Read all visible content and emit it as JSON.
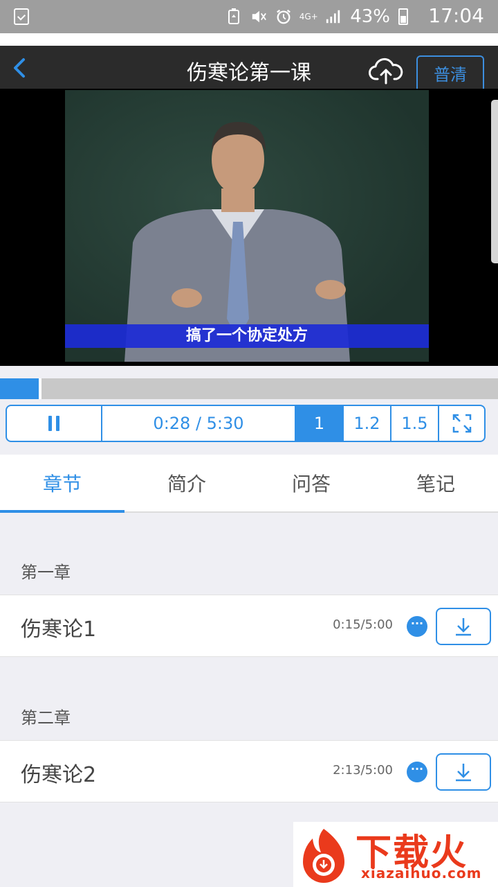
{
  "status_bar": {
    "battery_percent": "43%",
    "time": "17:04",
    "network": "4G+",
    "icons": [
      "screenshot-icon",
      "battery-saver-icon",
      "mute-icon",
      "alarm-icon",
      "network-4g-icon",
      "signal-icon",
      "battery-icon"
    ]
  },
  "header": {
    "title": "伤寒论第一课",
    "quality_label": "普清",
    "icons": [
      "back-icon",
      "cloud-upload-icon"
    ]
  },
  "video": {
    "subtitle": "搞了一个协定处方"
  },
  "player": {
    "progress_fraction": 0.085,
    "time_display": "0:28 / 5:30",
    "speeds": [
      "1",
      "1.2",
      "1.5"
    ],
    "active_speed": "1",
    "icons": [
      "pause-icon",
      "fullscreen-icon"
    ]
  },
  "tabs": [
    {
      "label": "章节",
      "active": true
    },
    {
      "label": "简介",
      "active": false
    },
    {
      "label": "问答",
      "active": false
    },
    {
      "label": "笔记",
      "active": false
    }
  ],
  "chapters": [
    {
      "title": "第一章",
      "lesson": "伤寒论1",
      "progress": "0:15/5:00"
    },
    {
      "title": "第二章",
      "lesson": "伤寒论2",
      "progress": "2:13/5:00"
    }
  ],
  "watermark": {
    "name": "下载火",
    "domain": "xiazaihuo.com"
  },
  "colors": {
    "accent": "#2f8fe6",
    "title_bar": "#2b2b2b",
    "status_bar": "#9e9e9e",
    "watermark": "#ea3a1c"
  }
}
